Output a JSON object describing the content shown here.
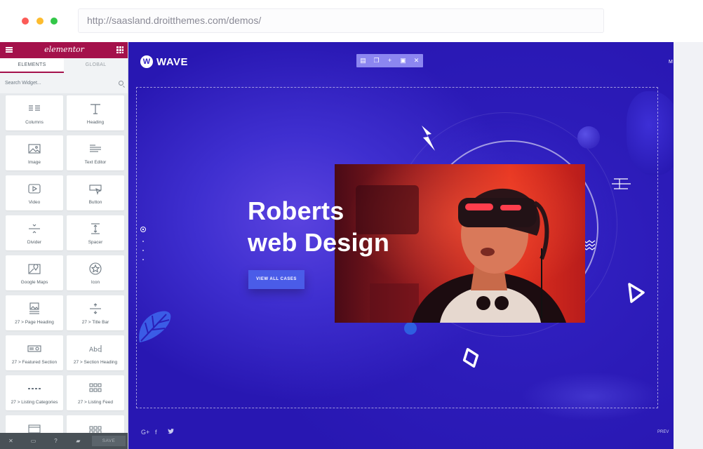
{
  "browser": {
    "url": "http://saasland.droitthemes.com/demos/"
  },
  "elementor_panel": {
    "brand": "elementor",
    "tabs": [
      "ELEMENTS",
      "GLOBAL"
    ],
    "search_placeholder": "Search Widget...",
    "widgets": [
      {
        "label": "Columns",
        "icon": "columns-icon"
      },
      {
        "label": "Heading",
        "icon": "heading-icon"
      },
      {
        "label": "Image",
        "icon": "image-icon"
      },
      {
        "label": "Text Editor",
        "icon": "text-editor-icon"
      },
      {
        "label": "Video",
        "icon": "video-icon"
      },
      {
        "label": "Button",
        "icon": "button-icon"
      },
      {
        "label": "Divider",
        "icon": "divider-icon"
      },
      {
        "label": "Spacer",
        "icon": "spacer-icon"
      },
      {
        "label": "Google Maps",
        "icon": "map-icon"
      },
      {
        "label": "Icon",
        "icon": "star-icon"
      },
      {
        "label": "27 > Page Heading",
        "icon": "page-heading-icon"
      },
      {
        "label": "27 > Title Bar",
        "icon": "title-bar-icon"
      },
      {
        "label": "27 > Featured Section",
        "icon": "featured-section-icon"
      },
      {
        "label": "27 > Section Heading",
        "icon": "section-heading-icon"
      },
      {
        "label": "27 > Listing Categories",
        "icon": "listing-categories-icon"
      },
      {
        "label": "27 > Listing Feed",
        "icon": "listing-feed-icon"
      }
    ],
    "footer": {
      "save_label": "SAVE"
    }
  },
  "site": {
    "logo_letter": "W",
    "logo_text": "WAVE",
    "nav_partial": "M",
    "headline_line1": "Roberts",
    "headline_line2": "web Design",
    "cta_label": "VIEW ALL CASES",
    "prev_label": "PREV",
    "social": [
      "G+",
      "f",
      "t"
    ]
  },
  "colors": {
    "elementor_brand": "#a4114b",
    "canvas_blue": "#3322c4",
    "cta_blue": "#4a5ce8"
  }
}
